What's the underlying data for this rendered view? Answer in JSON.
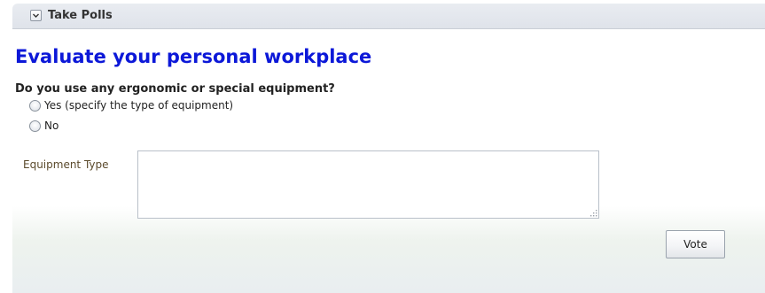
{
  "header": {
    "title": "Take Polls",
    "toggle_icon": "chevron-down-icon"
  },
  "poll": {
    "title": "Evaluate your personal workplace",
    "question": "Do you use any ergonomic or special equipment?",
    "options": [
      {
        "label": "Yes (specify the type of equipment)",
        "selected": false
      },
      {
        "label": "No",
        "selected": false
      }
    ],
    "field": {
      "label": "Equipment Type",
      "value": ""
    },
    "vote_label": "Vote"
  },
  "colors": {
    "title_blue": "#0c18d8",
    "field_label": "#5b4a2c",
    "header_bg": "#dfe3ea"
  }
}
